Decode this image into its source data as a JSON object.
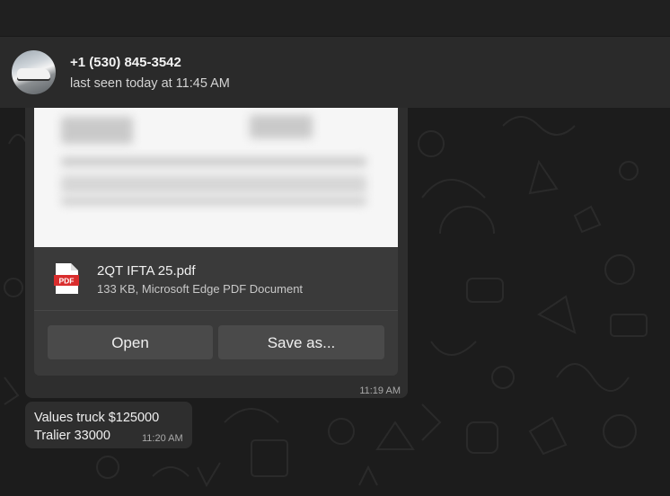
{
  "contact": {
    "name": "+1 (530) 845-3542",
    "status": "last seen today at 11:45 AM"
  },
  "messages": [
    {
      "type": "document",
      "file_name": "2QT IFTA 25.pdf",
      "file_meta": "133 KB, Microsoft Edge PDF Document",
      "file_icon_label": "PDF",
      "open_label": "Open",
      "save_label": "Save as...",
      "time": "11:19 AM"
    },
    {
      "type": "text",
      "line1": "Values truck $125000",
      "line2": "Tralier 33000",
      "time": "11:20 AM"
    }
  ],
  "colors": {
    "background": "#1c1c1c",
    "header": "#2a2a2a",
    "bubble": "#2e2e2e",
    "button": "#4a4a4a",
    "pdf_red": "#d92d2d"
  }
}
